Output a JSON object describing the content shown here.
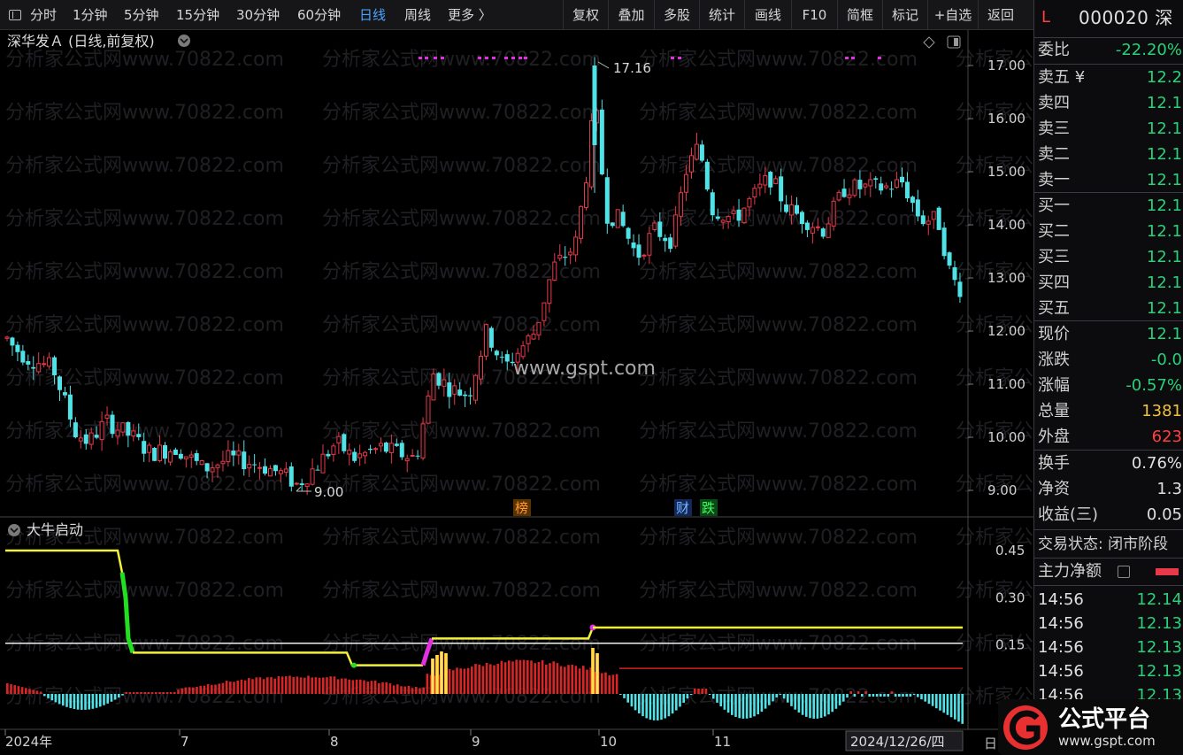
{
  "toolbar": {
    "left_icon": "panel-toggle-icon",
    "periods": [
      "分时",
      "1分钟",
      "5分钟",
      "15分钟",
      "30分钟",
      "60分钟",
      "日线",
      "周线",
      "更多 〉"
    ],
    "active_period": "日线",
    "actions": [
      "复权",
      "叠加",
      "多股",
      "统计",
      "画线",
      "F10",
      "简框",
      "标记",
      "+自选",
      "返回"
    ]
  },
  "chart_header": {
    "title": "深华发Ａ (日线,前复权)",
    "watermark_center": "www.gspt.com",
    "watermark_text": "分析家公式网www.70822.com",
    "high_label": "17.16",
    "low_label": "9.00"
  },
  "price_axis": [
    "17.00",
    "16.00",
    "15.00",
    "14.00",
    "13.00",
    "12.00",
    "11.00",
    "10.00",
    "9.00"
  ],
  "event_markers": [
    "榜",
    "财",
    "跌"
  ],
  "indicator": {
    "name": "大牛启动",
    "axis": [
      "0.45",
      "0.30",
      "0.15"
    ]
  },
  "date_axis": {
    "labels": [
      "2024年",
      "7",
      "8",
      "9",
      "10",
      "11"
    ],
    "current_date": "2024/12/26/四",
    "corner": "日"
  },
  "quote": {
    "flag": "L",
    "code": "000020 深",
    "weibi_label": "委比",
    "weibi_value": "-22.20%",
    "asks": [
      {
        "label": "卖五 ¥",
        "value": "12.2"
      },
      {
        "label": "卖四",
        "value": "12.1"
      },
      {
        "label": "卖三",
        "value": "12.1"
      },
      {
        "label": "卖二",
        "value": "12.1"
      },
      {
        "label": "卖一",
        "value": "12.1"
      }
    ],
    "bids": [
      {
        "label": "买一",
        "value": "12.1"
      },
      {
        "label": "买二",
        "value": "12.1"
      },
      {
        "label": "买三",
        "value": "12.1"
      },
      {
        "label": "买四",
        "value": "12.1"
      },
      {
        "label": "买五",
        "value": "12.1"
      }
    ],
    "stats": [
      {
        "label": "现价",
        "value": "12.1"
      },
      {
        "label": "涨跌",
        "value": "-0.0"
      },
      {
        "label": "涨幅",
        "value": "-0.57%"
      },
      {
        "label": "总量",
        "value": "1381"
      },
      {
        "label": "外盘",
        "value": "623"
      }
    ],
    "stats2": [
      {
        "label": "换手",
        "value": "0.76%"
      },
      {
        "label": "净资",
        "value": "1.3"
      },
      {
        "label": "收益(三)",
        "value": "0.05"
      }
    ],
    "status_label": "交易状态: 闭市阶段",
    "main_flow_label": "主力净额",
    "ticks": [
      {
        "time": "14:56",
        "price": "12.14"
      },
      {
        "time": "14:56",
        "price": "12.13"
      },
      {
        "time": "14:56",
        "price": "12.13"
      },
      {
        "time": "14:56",
        "price": "12.13"
      },
      {
        "time": "14:56",
        "price": "12.13"
      }
    ]
  },
  "logo": {
    "text": "公式平台",
    "url": "www.gspt.com"
  },
  "colors": {
    "up": "#e8394a",
    "down": "#4fe3e8",
    "yellow": "#f2f23a",
    "green": "#20e020",
    "magenta": "#e030e0",
    "accent": "#4aa3ff"
  }
}
